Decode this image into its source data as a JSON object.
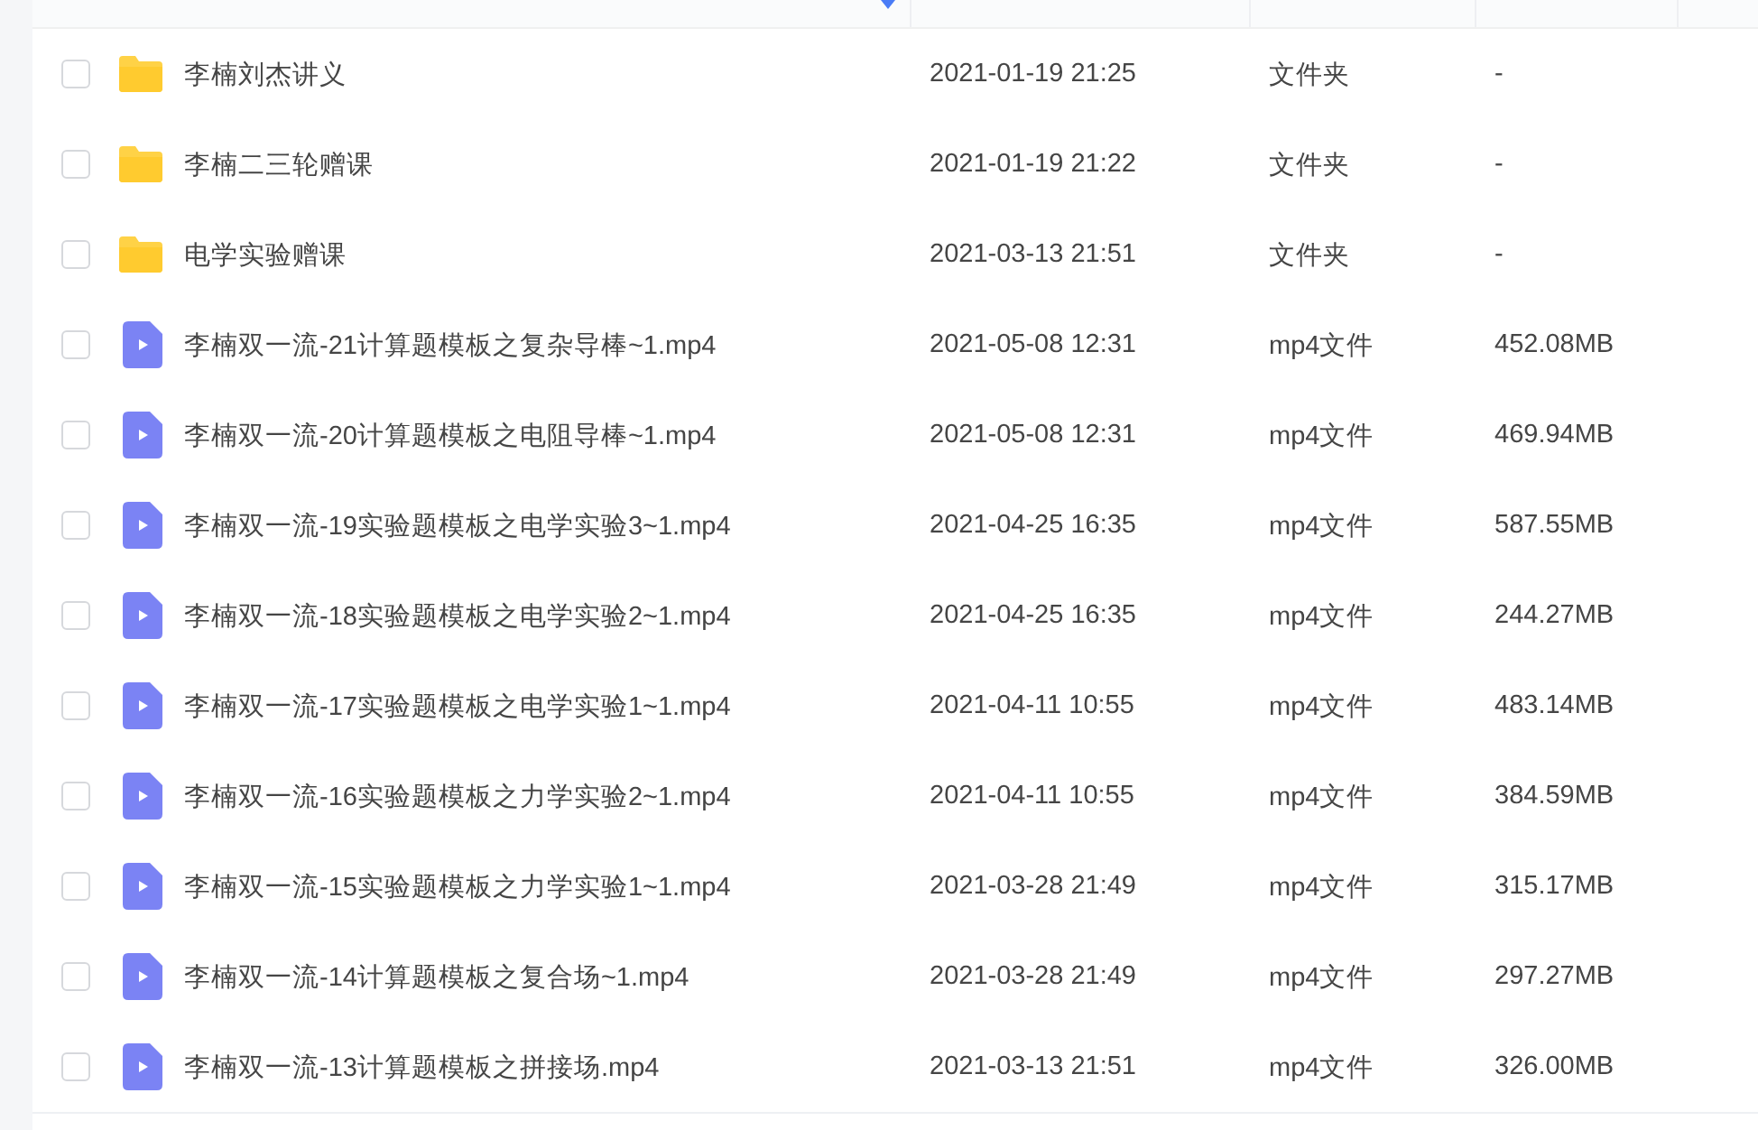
{
  "file_list": {
    "rows": [
      {
        "kind": "folder",
        "selected": false,
        "name": "李楠刘杰讲义",
        "modified": "2021-01-19 21:25",
        "type": "文件夹",
        "size": "-"
      },
      {
        "kind": "folder",
        "selected": false,
        "name": "李楠二三轮赠课",
        "modified": "2021-01-19 21:22",
        "type": "文件夹",
        "size": "-"
      },
      {
        "kind": "folder",
        "selected": false,
        "name": "电学实验赠课",
        "modified": "2021-03-13 21:51",
        "type": "文件夹",
        "size": "-"
      },
      {
        "kind": "video",
        "selected": false,
        "name": "李楠双一流-21计算题模板之复杂导棒~1.mp4",
        "modified": "2021-05-08 12:31",
        "type": "mp4文件",
        "size": "452.08MB"
      },
      {
        "kind": "video",
        "selected": false,
        "name": "李楠双一流-20计算题模板之电阻导棒~1.mp4",
        "modified": "2021-05-08 12:31",
        "type": "mp4文件",
        "size": "469.94MB"
      },
      {
        "kind": "video",
        "selected": false,
        "name": "李楠双一流-19实验题模板之电学实验3~1.mp4",
        "modified": "2021-04-25 16:35",
        "type": "mp4文件",
        "size": "587.55MB"
      },
      {
        "kind": "video",
        "selected": false,
        "name": "李楠双一流-18实验题模板之电学实验2~1.mp4",
        "modified": "2021-04-25 16:35",
        "type": "mp4文件",
        "size": "244.27MB"
      },
      {
        "kind": "video",
        "selected": false,
        "name": "李楠双一流-17实验题模板之电学实验1~1.mp4",
        "modified": "2021-04-11 10:55",
        "type": "mp4文件",
        "size": "483.14MB"
      },
      {
        "kind": "video",
        "selected": false,
        "name": "李楠双一流-16实验题模板之力学实验2~1.mp4",
        "modified": "2021-04-11 10:55",
        "type": "mp4文件",
        "size": "384.59MB"
      },
      {
        "kind": "video",
        "selected": false,
        "name": "李楠双一流-15实验题模板之力学实验1~1.mp4",
        "modified": "2021-03-28 21:49",
        "type": "mp4文件",
        "size": "315.17MB"
      },
      {
        "kind": "video",
        "selected": false,
        "name": "李楠双一流-14计算题模板之复合场~1.mp4",
        "modified": "2021-03-28 21:49",
        "type": "mp4文件",
        "size": "297.27MB"
      },
      {
        "kind": "video",
        "selected": false,
        "name": "李楠双一流-13计算题模板之拼接场.mp4",
        "modified": "2021-03-13 21:51",
        "type": "mp4文件",
        "size": "326.00MB"
      }
    ]
  }
}
